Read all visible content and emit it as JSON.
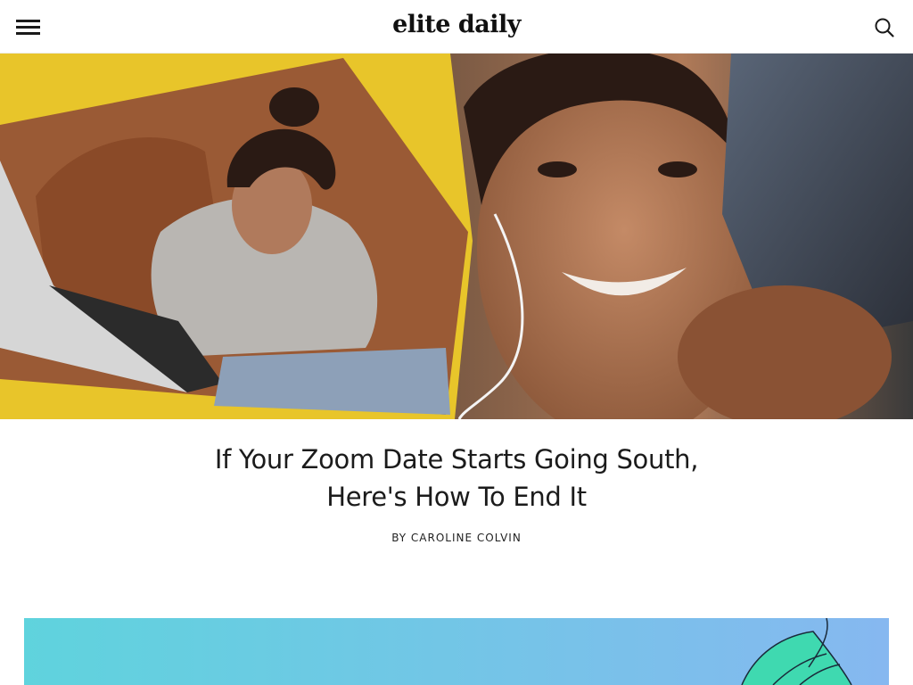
{
  "header": {
    "logo_text": "elite daily",
    "menu_icon": "hamburger-menu-icon",
    "search_icon": "search-icon"
  },
  "hero": {
    "image_description_icon": "hero-photo",
    "accent_color": "#e8c52a"
  },
  "article": {
    "title": "If Your Zoom Date Starts Going South, Here's How To End It",
    "byline_prefix": "BY",
    "author": "CAROLINE COLVIN"
  },
  "inline_image": {
    "gradient_start": "#5fd3dd",
    "gradient_end": "#86b8f0",
    "leaf_color": "#3fd9b0"
  }
}
